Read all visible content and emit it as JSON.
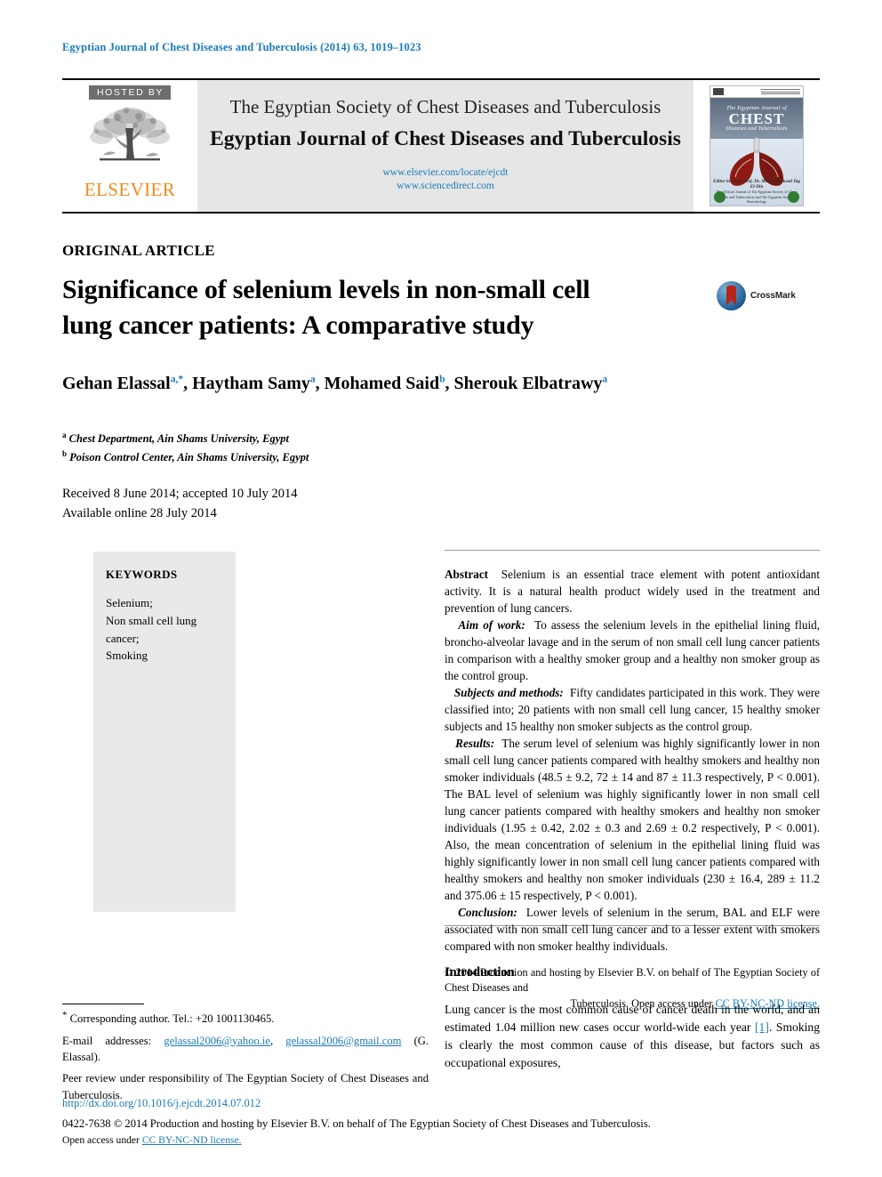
{
  "running_head": "Egyptian Journal of Chest Diseases and Tuberculosis (2014) 63, 1019–1023",
  "masthead": {
    "hosted_by": "HOSTED BY",
    "publisher": "ELSEVIER",
    "society_line": "The Egyptian Society of Chest Diseases and Tuberculosis",
    "journal_title": "Egyptian Journal of Chest Diseases and Tuberculosis",
    "url_publisher": "www.elsevier.com/locate/ejcdt",
    "url_sciencedirect": "www.sciencedirect.com",
    "cover": {
      "line1": "The Egyptian Journal of",
      "line2": "CHEST",
      "line3": "Diseases and Tuberculosis",
      "foot1": "Editor in chief: Prof. Dr. Mohamed Awad Tag El-Din",
      "foot2": "The Official Journal of The Egyptian Society of Chest Diseases and Tuberculosis and The Egyptian Society of Bronchology"
    }
  },
  "article": {
    "type": "ORIGINAL ARTICLE",
    "title_line1": "Significance of selenium levels in non-small cell",
    "title_line2": "lung cancer patients: A comparative study",
    "crossmark_label": "CrossMark",
    "authors": [
      {
        "name": "Gehan Elassal",
        "sup": "a,*"
      },
      {
        "name": "Haytham Samy",
        "sup": "a"
      },
      {
        "name": "Mohamed Said",
        "sup": "b"
      },
      {
        "name": "Sherouk Elbatrawy",
        "sup": "a"
      }
    ],
    "affiliations": [
      {
        "mark": "a",
        "text": "Chest Department, Ain Shams University, Egypt"
      },
      {
        "mark": "b",
        "text": "Poison Control Center, Ain Shams University, Egypt"
      }
    ],
    "received_line": "Received 8 June 2014; accepted 10 July 2014",
    "available_line": "Available online 28 July 2014"
  },
  "keywords": {
    "heading": "KEYWORDS",
    "items": [
      "Selenium;",
      "Non small cell lung cancer;",
      "Smoking"
    ]
  },
  "abstract": {
    "label": "Abstract",
    "intro": "Selenium is an essential trace element with potent antioxidant activity. It is a natural health product widely used in the treatment and prevention of lung cancers.",
    "aim_label": "Aim of work:",
    "aim": "To assess the selenium levels in the epithelial lining fluid, broncho-alveolar lavage and in the serum of non small cell lung cancer patients in comparison with a healthy smoker group and a healthy non smoker group as the control group.",
    "methods_label": "Subjects and methods:",
    "methods": "Fifty candidates participated in this work. They were classified into; 20 patients with non small cell lung cancer, 15 healthy smoker subjects and 15 healthy non smoker subjects as the control group.",
    "results_label": "Results:",
    "results": "The serum level of selenium was highly significantly lower in non small cell lung cancer patients compared with healthy smokers and healthy non smoker individuals (48.5 ± 9.2, 72 ± 14 and 87 ± 11.3 respectively, P < 0.001). The BAL level of selenium was highly significantly lower in non small cell lung cancer patients compared with healthy smokers and healthy non smoker individuals (1.95 ± 0.42, 2.02 ± 0.3 and 2.69 ± 0.2 respectively, P < 0.001). Also, the mean concentration of selenium in the epithelial lining fluid was highly significantly lower in non small cell lung cancer patients compared with healthy smokers and healthy non smoker individuals (230 ± 16.4, 289 ± 11.2 and 375.06 ± 15 respectively, P < 0.001).",
    "conclusion_label": "Conclusion:",
    "conclusion": "Lower levels of selenium in the serum, BAL and ELF were associated with non small cell lung cancer and to a lesser extent with smokers compared with non smoker healthy individuals.",
    "copyright_main": "© 2014 Production and hosting by Elsevier B.V. on behalf of The Egyptian Society of Chest Diseases and",
    "copyright_tail": "Tuberculosis. Open access under ",
    "copyright_link": "CC BY-NC-ND license."
  },
  "introduction": {
    "heading": "Introduction",
    "text_a": "Lung cancer is the most common cause of cancer death in the world, and an estimated 1.04 million new cases occur world-wide each year ",
    "ref": "[1]",
    "text_b": ". Smoking is clearly the most common cause of this disease, but factors such as occupational exposures,"
  },
  "footnotes": {
    "corresponding": "Corresponding author. Tel.: +20 1001130465.",
    "email_label": "E-mail addresses:",
    "email1": "gelassal2006@yahoo.ie",
    "email_sep": ", ",
    "email2": "gelassal2006@gmail.com",
    "email_owner": "(G. Elassal).",
    "peer_review": "Peer review under responsibility of The Egyptian Society of Chest Diseases and Tuberculosis."
  },
  "footer": {
    "doi": "http://dx.doi.org/10.1016/j.ejcdt.2014.07.012",
    "issn_copy": "0422-7638 © 2014 Production and hosting by Elsevier B.V. on behalf of The Egyptian Society of Chest Diseases and Tuberculosis.",
    "open_access": "Open access under ",
    "open_access_link": "CC BY-NC-ND license."
  },
  "colors": {
    "link_blue": "#1a7bb9",
    "elsevier_orange": "#f08a1c",
    "panel_grey": "#e6e6e6",
    "keyword_grey": "#e9e9e9"
  }
}
